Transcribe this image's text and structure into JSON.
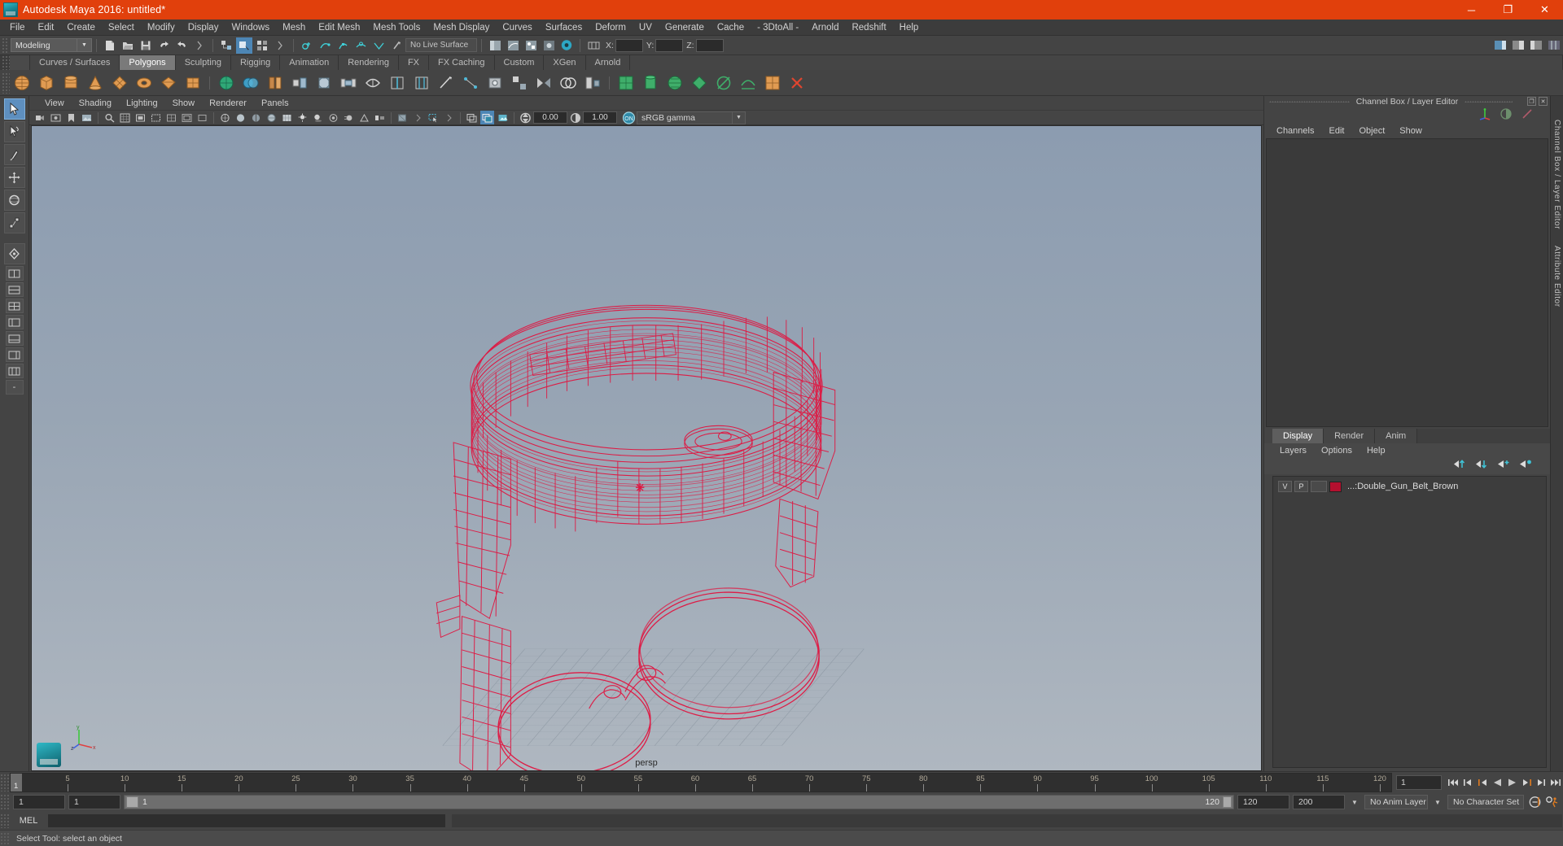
{
  "window": {
    "title": "Autodesk Maya 2016: untitled*",
    "logo_icon": "maya-logo-icon",
    "minimize_label": "─",
    "maximize_label": "❐",
    "close_label": "✕"
  },
  "main_menu": [
    "File",
    "Edit",
    "Create",
    "Select",
    "Modify",
    "Display",
    "Windows",
    "Mesh",
    "Edit Mesh",
    "Mesh Tools",
    "Mesh Display",
    "Curves",
    "Surfaces",
    "Deform",
    "UV",
    "Generate",
    "Cache",
    "- 3DtoAll -",
    "Arnold",
    "Redshift",
    "Help"
  ],
  "status_line": {
    "selection_mode": "Modeling",
    "live_surface": "No Live Surface",
    "x_label": "X:",
    "y_label": "Y:",
    "z_label": "Z:",
    "x_value": "",
    "y_value": "",
    "z_value": ""
  },
  "shelf_tabs": [
    {
      "label": "Curves / Surfaces",
      "active": false
    },
    {
      "label": "Polygons",
      "active": true
    },
    {
      "label": "Sculpting",
      "active": false
    },
    {
      "label": "Rigging",
      "active": false
    },
    {
      "label": "Animation",
      "active": false
    },
    {
      "label": "Rendering",
      "active": false
    },
    {
      "label": "FX",
      "active": false
    },
    {
      "label": "FX Caching",
      "active": false
    },
    {
      "label": "Custom",
      "active": false
    },
    {
      "label": "XGen",
      "active": false
    },
    {
      "label": "Arnold",
      "active": false
    }
  ],
  "viewport_menu": [
    "View",
    "Shading",
    "Lighting",
    "Show",
    "Renderer",
    "Panels"
  ],
  "viewport_toolbar": {
    "exposure_value": "0.00",
    "gamma_value": "1.00",
    "color_management": "sRGB gamma",
    "color_management_toggle": "ON"
  },
  "viewport": {
    "camera_label": "persp",
    "background_top_color": "#8e9eb0",
    "background_bottom_color": "#adb5bf",
    "wireframe_color": "#e01540",
    "axis_x_label": "x",
    "axis_y_label": "y",
    "axis_z_label": "z"
  },
  "channel_box": {
    "panel_title": "Channel Box / Layer Editor",
    "menus": [
      "Channels",
      "Edit",
      "Object",
      "Show"
    ],
    "restore_icon": "restore-panel-icon",
    "close_icon": "close-panel-icon"
  },
  "layer_editor": {
    "tabs": [
      {
        "label": "Display",
        "active": true
      },
      {
        "label": "Render",
        "active": false
      },
      {
        "label": "Anim",
        "active": false
      }
    ],
    "menus": [
      "Layers",
      "Options",
      "Help"
    ],
    "toolbar_icons": [
      "layer-move-up-icon",
      "layer-move-down-icon",
      "layer-new-icon",
      "layer-new-from-selected-icon"
    ],
    "layers": [
      {
        "visibility": "V",
        "playback": "P",
        "shading": "",
        "color": "#b4102f",
        "name": "...:Double_Gun_Belt_Brown"
      }
    ]
  },
  "right_vertical_tabs": [
    "Channel Box / Layer Editor",
    "Attribute Editor"
  ],
  "time_slider": {
    "start_frame": "1",
    "current_frame": "1",
    "tick_labels": [
      "5",
      "10",
      "15",
      "20",
      "25",
      "30",
      "35",
      "40",
      "45",
      "50",
      "55",
      "60",
      "65",
      "70",
      "75",
      "80",
      "85",
      "90",
      "95",
      "100",
      "105",
      "110",
      "115",
      "120"
    ],
    "frame_field": "1",
    "playback_buttons": [
      "go-to-start-icon",
      "step-back-key-icon",
      "step-back-frame-icon",
      "play-backwards-icon",
      "play-forwards-icon",
      "step-forward-frame-icon",
      "step-forward-key-icon",
      "go-to-end-icon"
    ]
  },
  "range_slider": {
    "anim_start": "1",
    "playback_start": "1",
    "range_left_label": "1",
    "range_right_label": "120",
    "playback_end": "120",
    "anim_end": "200",
    "anim_layer": "No Anim Layer",
    "character_set": "No Character Set",
    "auto_key_icon": "auto-keyframe-icon",
    "anim_prefs_icon": "animation-preferences-icon"
  },
  "command_line": {
    "language_label": "MEL",
    "input_value": "",
    "output_value": ""
  },
  "status_bar": {
    "help_text": "Select Tool: select an object"
  },
  "toolbox": {
    "tools": [
      {
        "name": "select-tool",
        "active": true
      },
      {
        "name": "lasso-select-tool",
        "active": false
      },
      {
        "name": "paint-select-tool",
        "active": false
      },
      {
        "name": "move-tool",
        "active": false
      },
      {
        "name": "rotate-tool",
        "active": false
      },
      {
        "name": "scale-tool",
        "active": false
      }
    ]
  }
}
